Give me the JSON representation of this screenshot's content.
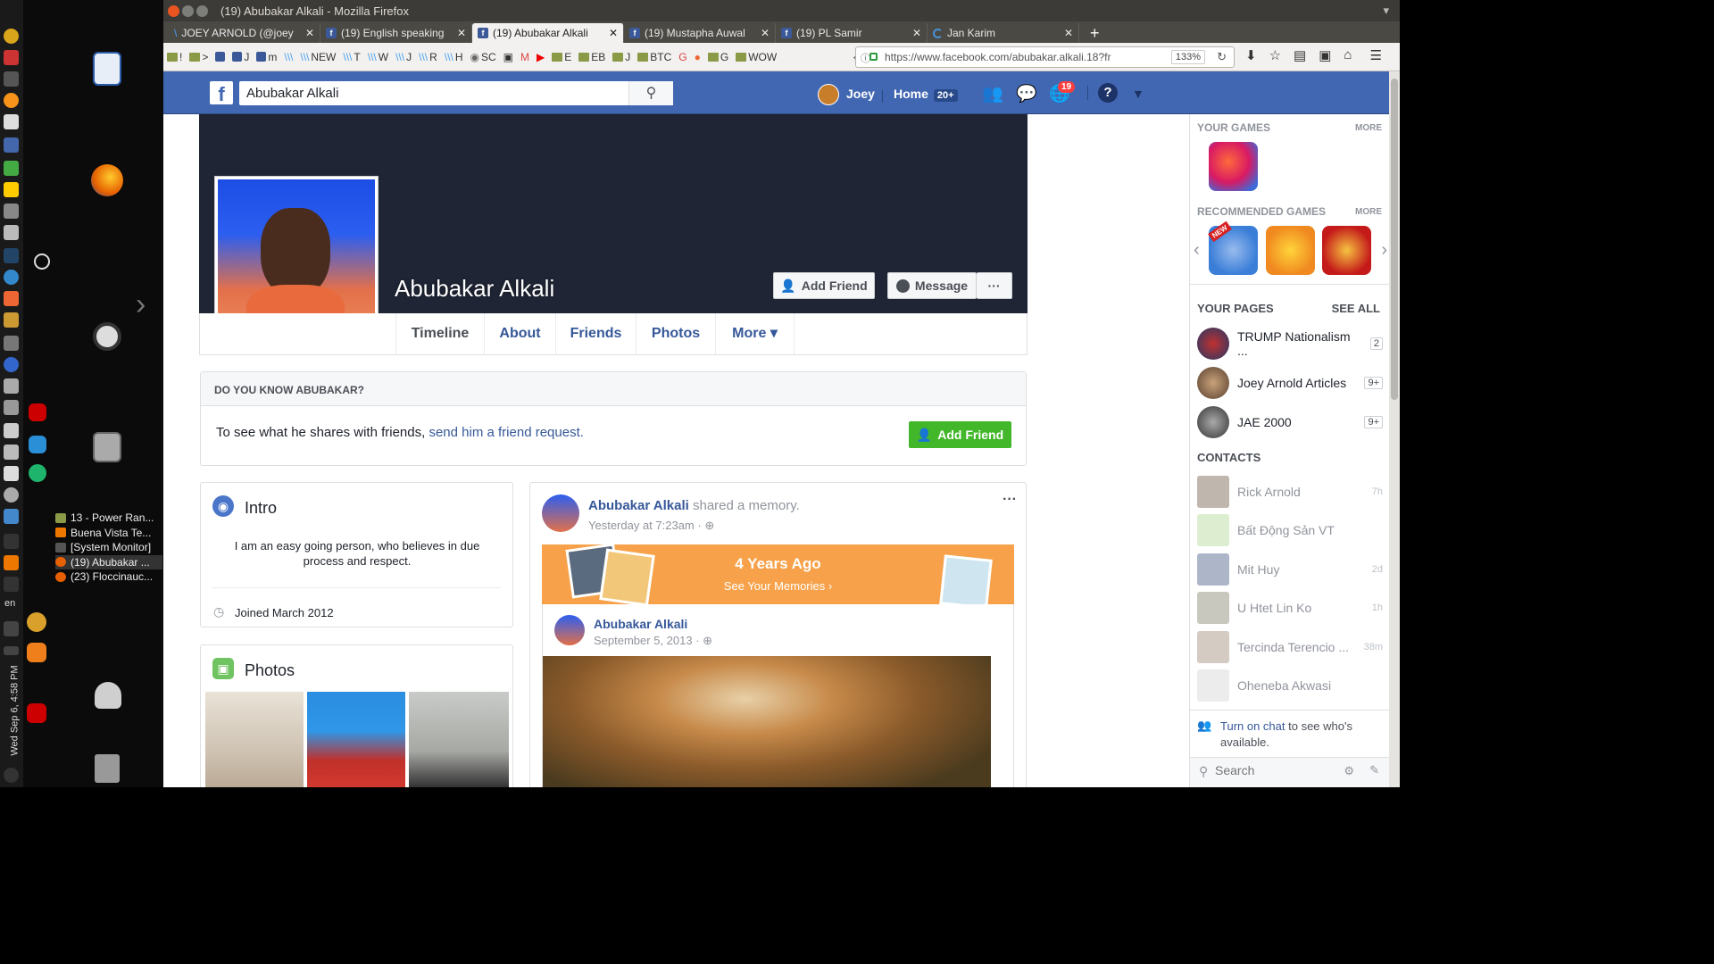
{
  "window": {
    "title": "(19) Abubakar Alkali - Mozilla Firefox"
  },
  "tabs": [
    {
      "label": "JOEY ARNOLD (@joey",
      "icon": "steemit"
    },
    {
      "label": "(19) English speaking",
      "icon": "facebook"
    },
    {
      "label": "(19) Abubakar Alkali",
      "icon": "facebook"
    },
    {
      "label": "(19) Mustapha Auwal",
      "icon": "facebook"
    },
    {
      "label": "(19) PL Samir",
      "icon": "facebook"
    },
    {
      "label": "Jan Karim",
      "icon": "loading"
    }
  ],
  "bookmarks": [
    "!",
    ">",
    "J",
    "m",
    "NEW",
    "T",
    "W",
    "J",
    "R",
    "H",
    "SC",
    "E",
    "EB",
    "J",
    "BTC",
    "G",
    "WOW"
  ],
  "url": "https://www.facebook.com/abubakar.alkali.18?fr",
  "zoom": "133%",
  "fb": {
    "search_value": "Abubakar Alkali",
    "user": "Joey",
    "home": "Home",
    "home_badge": "20+",
    "notif_badge": "19"
  },
  "profile": {
    "name": "Abubakar Alkali",
    "add_friend": "Add Friend",
    "message": "Message",
    "tabs": [
      "Timeline",
      "About",
      "Friends",
      "Photos",
      "More ▾"
    ]
  },
  "know": {
    "head": "DO YOU KNOW ABUBAKAR?",
    "text": "To see what he shares with friends,",
    "link": "send him a friend request.",
    "button": "Add Friend"
  },
  "intro": {
    "title": "Intro",
    "bio": "I am an easy going person, who believes in due process and respect.",
    "joined": "Joined March 2012"
  },
  "photos": {
    "title": "Photos"
  },
  "post": {
    "author": "Abubakar Alkali",
    "action": "shared a memory.",
    "time": "Yesterday at 7:23am · ",
    "memory_title": "4 Years Ago",
    "memory_link": "See Your Memories ›",
    "inner_author": "Abubakar Alkali",
    "inner_date": "September 5, 2013 · "
  },
  "right": {
    "your_games": "YOUR GAMES",
    "more1": "MORE",
    "recommended": "RECOMMENDED GAMES",
    "more2": "MORE",
    "new_badge": "NEW",
    "your_pages": "YOUR PAGES",
    "see_all": "SEE ALL",
    "pages": [
      {
        "name": "TRUMP Nationalism ...",
        "count": "2"
      },
      {
        "name": "Joey Arnold Articles",
        "count": "9+"
      },
      {
        "name": "JAE 2000",
        "count": "9+"
      }
    ],
    "contacts_head": "CONTACTS",
    "contacts": [
      {
        "name": "Rick Arnold",
        "time": "7h"
      },
      {
        "name": "Bất Động Sản VT",
        "time": ""
      },
      {
        "name": "Mit Huy",
        "time": "2d"
      },
      {
        "name": "U Htet Lin Ko",
        "time": "1h"
      },
      {
        "name": "Tercinda Terencio ...",
        "time": "38m"
      },
      {
        "name": "Oheneba Akwasi",
        "time": ""
      }
    ],
    "chat_link": "Turn on chat",
    "chat_text": " to see who's available.",
    "search_placeholder": "Search"
  },
  "dock": {
    "clock": "Wed Sep 6, 4:58 PM",
    "lang": "en",
    "tasks": [
      "13 - Power Ran...",
      "Buena Vista Te...",
      "[System Monitor]",
      "(19) Abubakar ...",
      "(23) Floccinauc..."
    ]
  },
  "colors": {
    "fb_blue": "#4267b2",
    "link": "#365899",
    "green": "#42b72a",
    "memory_orange": "#f7a24a"
  }
}
